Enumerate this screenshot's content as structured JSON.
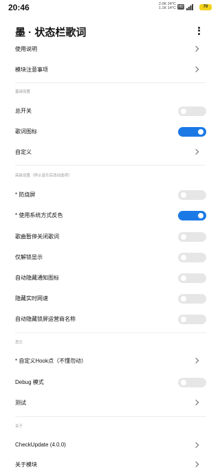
{
  "status_bar": {
    "time": "20:46",
    "net_speed_up": "2.0K 24°C",
    "net_speed_down": "1.1K 14°C",
    "hd_icon": "hd-icon",
    "signal_icon": "signal-icon",
    "battery": "70"
  },
  "header": {
    "title": "墨 · 状态栏歌词",
    "more_icon": "more-vertical-icon"
  },
  "items": {
    "usage": "使用说明",
    "notes": "模块注意事项",
    "section_basic": "基础设置",
    "master_switch": "总开关",
    "lyric_icon": "歌词图标",
    "custom": "自定义",
    "section_advanced": "高级设置（停止音乐后改动选项）",
    "anti_burn": "* 防烧屏",
    "system_invert": "* 使用系统方式反色",
    "pause_close": "歌曲暂停关闭歌词",
    "unlock_only": "仅解锁显示",
    "auto_hide_notify": "自动隐藏通知图标",
    "hide_speed": "隐藏实时网速",
    "auto_hide_carrier": "自动隐藏锁屏运营商名称",
    "section_other": "其它",
    "custom_hook": "* 自定义Hook点（不懂勿动）",
    "debug": "Debug 模式",
    "test": "测试",
    "section_about": "关于",
    "check_update": "CheckUpdate (4.0.0)",
    "about_module": "关于模块"
  },
  "toggles": {
    "master_switch": false,
    "lyric_icon": true,
    "anti_burn": false,
    "system_invert": true,
    "pause_close": false,
    "unlock_only": false,
    "auto_hide_notify": false,
    "hide_speed": false,
    "auto_hide_carrier": false,
    "debug": false
  },
  "colors": {
    "accent": "#1b79e6",
    "toggle_off": "#e6e6e6",
    "battery": "#f2d21b"
  }
}
